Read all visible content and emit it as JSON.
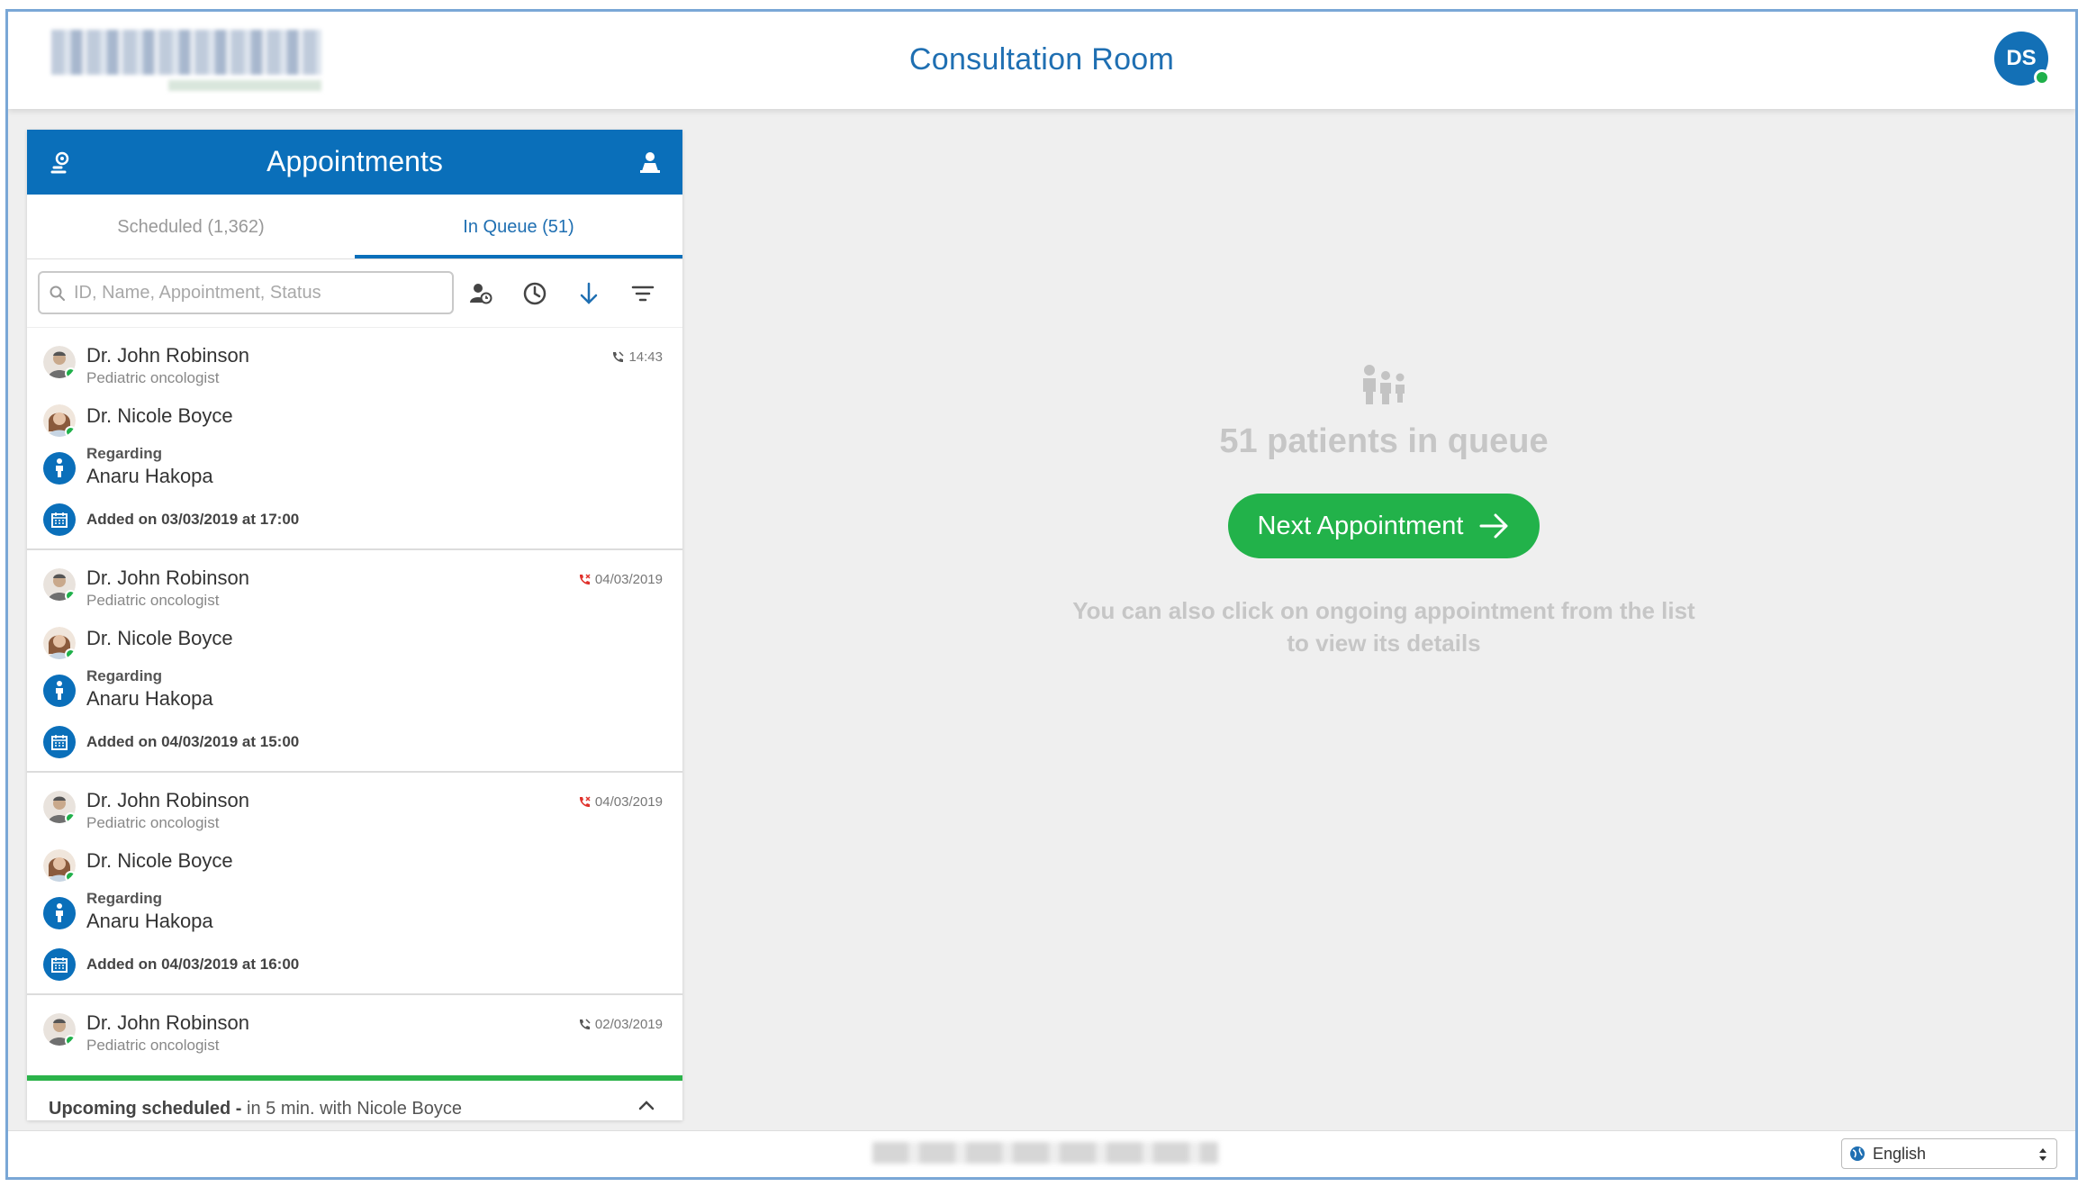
{
  "header": {
    "title": "Consultation Room",
    "user_initials": "DS"
  },
  "panel": {
    "title": "Appointments",
    "tabs": [
      {
        "label": "Scheduled (1,362)",
        "active": false
      },
      {
        "label": "In Queue (51)",
        "active": true
      }
    ],
    "search_placeholder": "ID, Name, Appointment, Status"
  },
  "appointments": [
    {
      "doctor": "Dr. John Robinson",
      "specialty": "Pediatric oncologist",
      "time": "14:43",
      "call_status": "ongoing",
      "colleague": "Dr. Nicole Boyce",
      "regarding_label": "Regarding",
      "patient": "Anaru Hakopa",
      "added": "Added on 03/03/2019 at 17:00"
    },
    {
      "doctor": "Dr. John Robinson",
      "specialty": "Pediatric oncologist",
      "time": "04/03/2019",
      "call_status": "missed",
      "colleague": "Dr. Nicole Boyce",
      "regarding_label": "Regarding",
      "patient": "Anaru Hakopa",
      "added": "Added on 04/03/2019 at 15:00"
    },
    {
      "doctor": "Dr. John Robinson",
      "specialty": "Pediatric oncologist",
      "time": "04/03/2019",
      "call_status": "missed",
      "colleague": "Dr. Nicole Boyce",
      "regarding_label": "Regarding",
      "patient": "Anaru Hakopa",
      "added": "Added on 04/03/2019 at 16:00"
    },
    {
      "doctor": "Dr. John Robinson",
      "specialty": "Pediatric oncologist",
      "time": "02/03/2019",
      "call_status": "ongoing"
    }
  ],
  "upcoming": {
    "label": "Upcoming scheduled -",
    "detail": " in 5 min. with Nicole Boyce"
  },
  "main": {
    "queue_text": "51 patients in queue",
    "next_button": "Next Appointment",
    "hint_line1": "You can also click on ongoing appointment from the list",
    "hint_line2": "to view its details"
  },
  "footer": {
    "language": "English"
  },
  "colors": {
    "primary": "#0a6fba",
    "success": "#22b24a",
    "missed": "#e0312b"
  }
}
